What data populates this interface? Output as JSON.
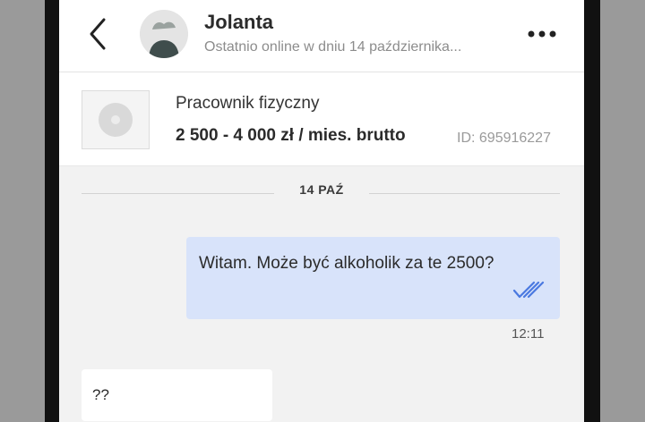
{
  "contact": {
    "name": "Jolanta",
    "status": "Ostatnio online w dniu 14 października..."
  },
  "icons": {
    "back": "chevron-left-icon",
    "avatar": "avatar-placeholder",
    "more": "more-dots-icon",
    "thumbnail": "image-placeholder-icon",
    "read": "double-check-icon"
  },
  "offer": {
    "title": "Pracownik fizyczny",
    "salary": "2 500 - 4 000 zł / mies. brutto",
    "id": "ID: 695916227"
  },
  "chat": {
    "date_label": "14 PAŹ",
    "messages": [
      {
        "direction": "outgoing",
        "text": "Witam. Może być alkoholik za te 2500?",
        "time": "12:11",
        "read": true
      },
      {
        "direction": "incoming",
        "text": "??"
      }
    ]
  },
  "colors": {
    "outgoing_bubble": "#d8e3fa",
    "read_ticks": "#4a79e0",
    "background": "#f2f2f2"
  }
}
